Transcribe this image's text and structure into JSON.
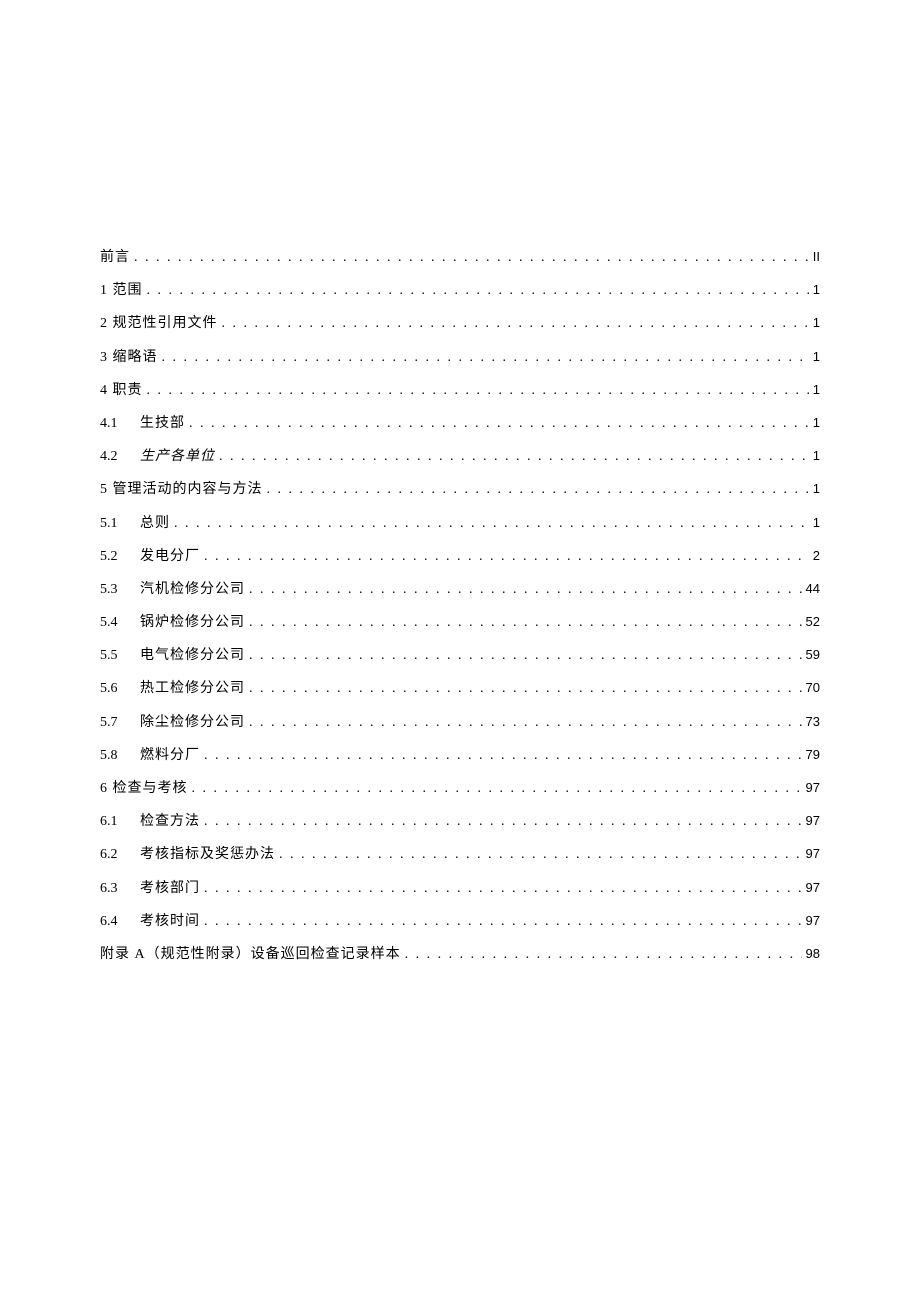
{
  "toc": {
    "entries": [
      {
        "label": "前言",
        "page": "II",
        "indented": false,
        "italic": false
      },
      {
        "label": "1 范围",
        "page": "1",
        "indented": false,
        "italic": false
      },
      {
        "label": "2 规范性引用文件",
        "page": "1",
        "indented": false,
        "italic": false
      },
      {
        "label": "3 缩略语",
        "page": "1",
        "indented": false,
        "italic": false
      },
      {
        "label": "4 职责",
        "page": "1",
        "indented": false,
        "italic": false
      },
      {
        "number": "4.1",
        "label": "生技部",
        "page": "1",
        "indented": true,
        "italic": false
      },
      {
        "number": "4.2",
        "label": "生产各单位",
        "page": "1",
        "indented": true,
        "italic": true
      },
      {
        "label": "5 管理活动的内容与方法",
        "page": "1",
        "indented": false,
        "italic": false
      },
      {
        "number": "5.1",
        "label": "总则",
        "page": "1",
        "indented": true,
        "italic": false
      },
      {
        "number": "5.2",
        "label": "发电分厂",
        "page": "2",
        "indented": true,
        "italic": false
      },
      {
        "number": "5.3",
        "label": "汽机检修分公司",
        "page": "44",
        "indented": true,
        "italic": false
      },
      {
        "number": "5.4",
        "label": "锅炉检修分公司",
        "page": "52",
        "indented": true,
        "italic": false
      },
      {
        "number": "5.5",
        "label": "电气检修分公司",
        "page": "59",
        "indented": true,
        "italic": false
      },
      {
        "number": "5.6",
        "label": "热工检修分公司",
        "page": "70",
        "indented": true,
        "italic": false
      },
      {
        "number": "5.7",
        "label": "除尘检修分公司",
        "page": "73",
        "indented": true,
        "italic": false
      },
      {
        "number": "5.8",
        "label": "燃料分厂",
        "page": "79",
        "indented": true,
        "italic": false
      },
      {
        "label": "6 检查与考核",
        "page": "97",
        "indented": false,
        "italic": false
      },
      {
        "number": "6.1",
        "label": "检查方法",
        "page": "97",
        "indented": true,
        "italic": false
      },
      {
        "number": "6.2",
        "label": "考核指标及奖惩办法",
        "page": "97",
        "indented": true,
        "italic": false
      },
      {
        "number": "6.3",
        "label": "考核部门",
        "page": "97",
        "indented": true,
        "italic": false
      },
      {
        "number": "6.4",
        "label": "考核时间",
        "page": "97",
        "indented": true,
        "italic": false
      },
      {
        "label": "附录 A（规范性附录）设备巡回检查记录样本",
        "page": "98",
        "indented": false,
        "italic": false
      }
    ]
  },
  "dots": ". . . . . . . . . . . . . . . . . . . . . . . . . . . . . . . . . . . . . . . . . . . . . . . . . . . . . . . . . . . . . . . . . . . . . . . . . . . . . . . . . . . . . . . . . . . . . . . . . . . . . . . . . . . . . . . . . . . . . . . . . . . . . . . . . . . . . . . . . . . . . . . . . . ."
}
